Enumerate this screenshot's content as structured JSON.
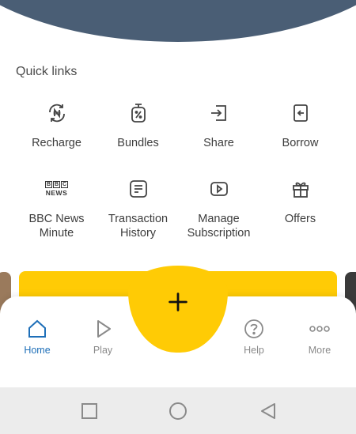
{
  "quick_links": {
    "title": "Quick links",
    "items": [
      {
        "label": "Recharge",
        "icon": "naira-refresh-icon"
      },
      {
        "label": "Bundles",
        "icon": "percent-stopwatch-icon"
      },
      {
        "label": "Share",
        "icon": "share-arrow-icon"
      },
      {
        "label": "Borrow",
        "icon": "borrow-arrow-icon"
      },
      {
        "label": "BBC News\nMinute",
        "icon": "bbc-news-icon",
        "logo_letters": [
          "B",
          "B",
          "C"
        ],
        "logo_word": "NEWS"
      },
      {
        "label": "Transaction\nHistory",
        "icon": "receipt-icon"
      },
      {
        "label": "Manage\nSubscription",
        "icon": "play-box-icon"
      },
      {
        "label": "Offers",
        "icon": "gift-icon"
      }
    ]
  },
  "bottom_nav": {
    "items": [
      {
        "label": "Home",
        "icon": "home-icon",
        "active": true
      },
      {
        "label": "Play",
        "icon": "play-icon",
        "active": false
      },
      {
        "label": "Help",
        "icon": "help-icon",
        "active": false
      },
      {
        "label": "More",
        "icon": "more-dots-icon",
        "active": false
      }
    ],
    "fab_icon": "plus-icon"
  },
  "colors": {
    "header": "#4a5e75",
    "accent_yellow": "#ffcb05",
    "active_blue": "#1e6fb8",
    "inactive_gray": "#8a8a8a"
  },
  "system_bar": {
    "buttons": [
      "recent-apps-icon",
      "home-circle-icon",
      "back-triangle-icon"
    ]
  }
}
